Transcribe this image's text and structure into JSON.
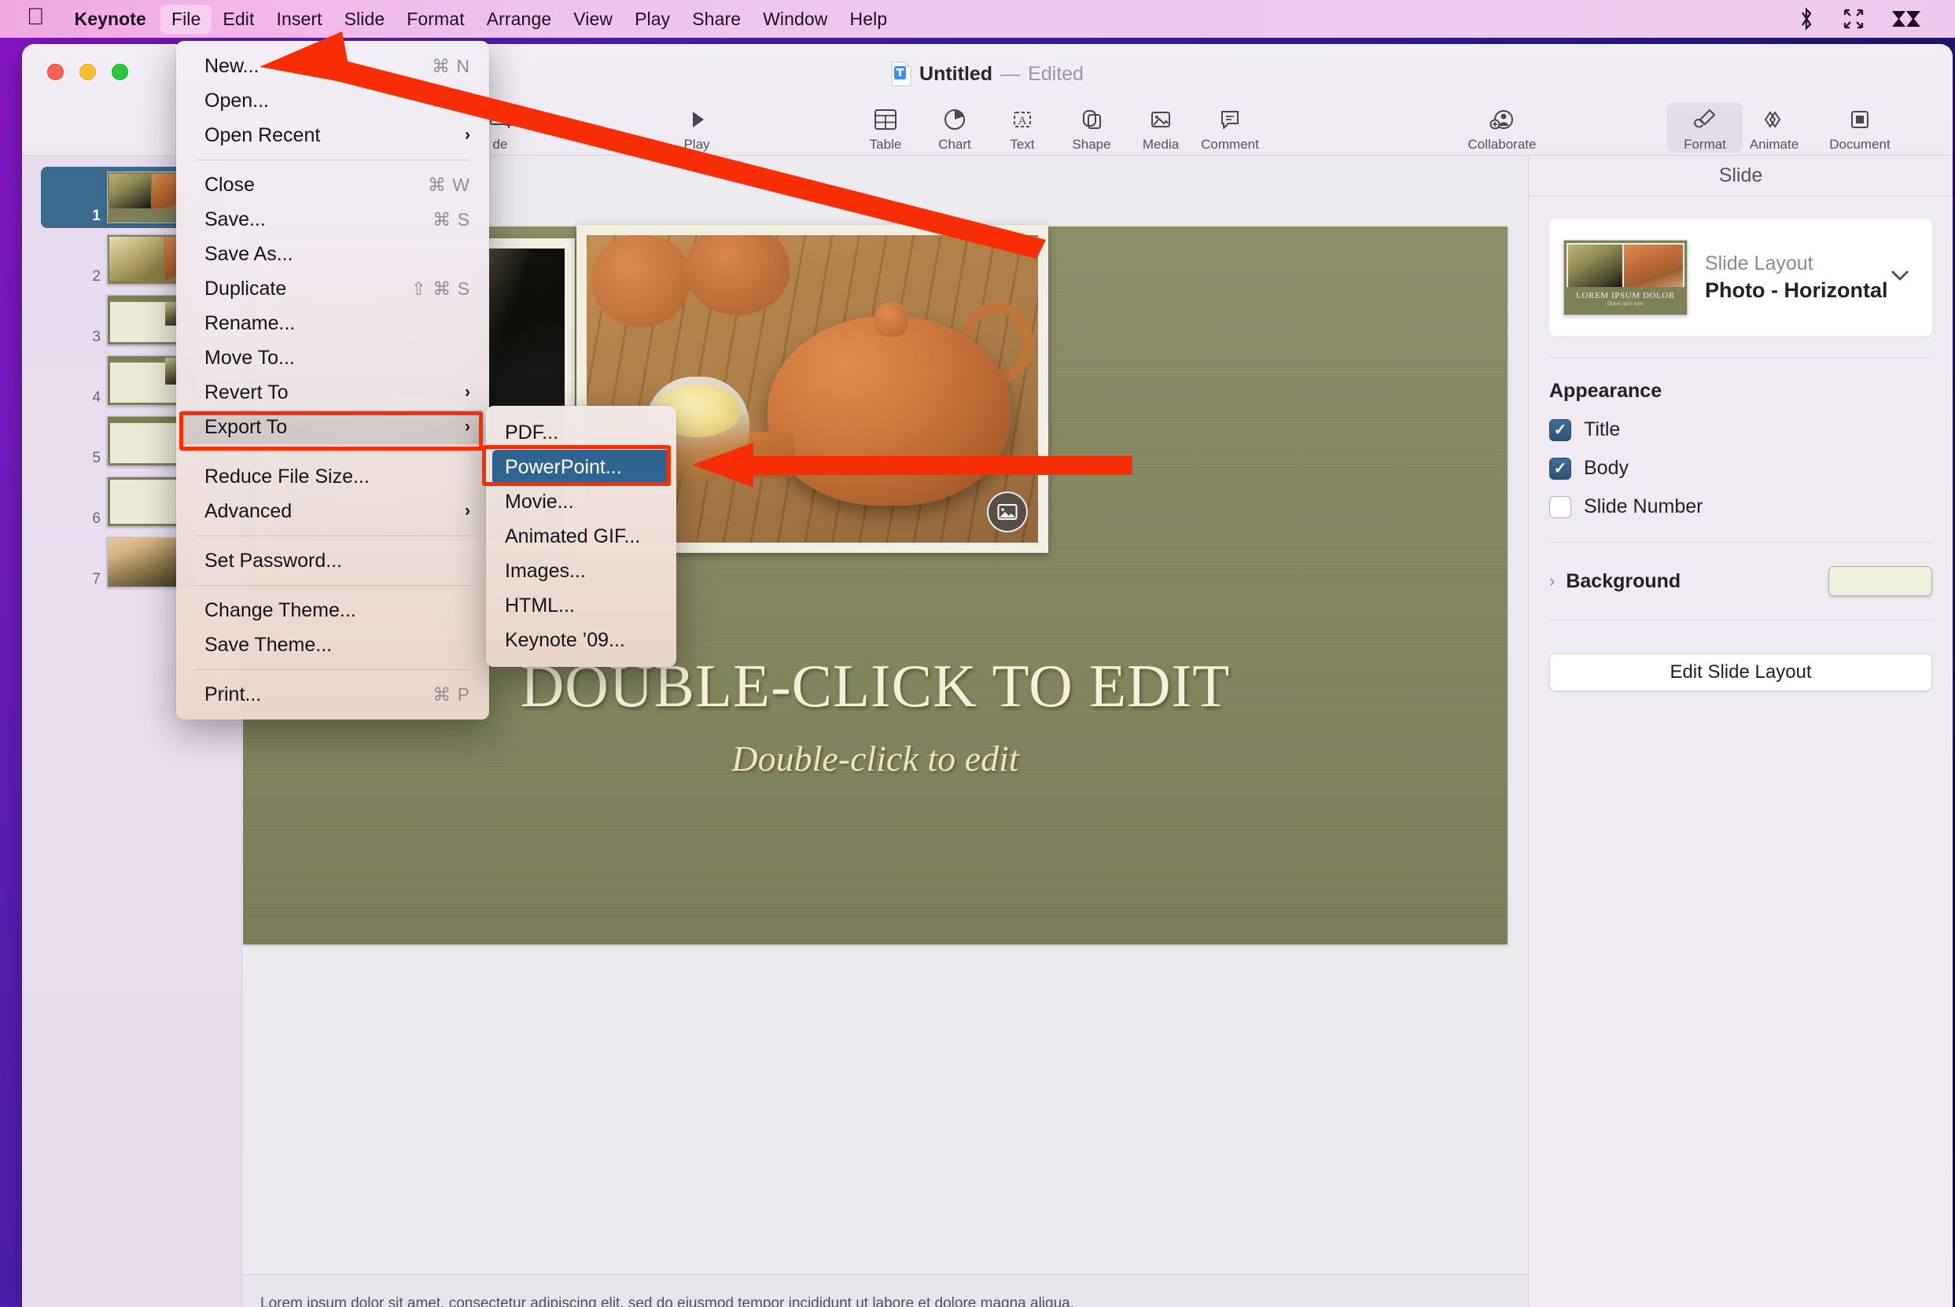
{
  "menubar": {
    "apple_icon": "apple-logo-icon",
    "items": [
      {
        "label": "Keynote",
        "bold": true,
        "active": false
      },
      {
        "label": "File",
        "bold": false,
        "active": true
      },
      {
        "label": "Edit",
        "bold": false,
        "active": false
      },
      {
        "label": "Insert",
        "bold": false,
        "active": false
      },
      {
        "label": "Slide",
        "bold": false,
        "active": false
      },
      {
        "label": "Format",
        "bold": false,
        "active": false
      },
      {
        "label": "Arrange",
        "bold": false,
        "active": false
      },
      {
        "label": "View",
        "bold": false,
        "active": false
      },
      {
        "label": "Play",
        "bold": false,
        "active": false
      },
      {
        "label": "Share",
        "bold": false,
        "active": false
      },
      {
        "label": "Window",
        "bold": false,
        "active": false
      },
      {
        "label": "Help",
        "bold": false,
        "active": false
      }
    ],
    "status_icons": [
      "bluetooth-icon",
      "fullscreen-arrows-icon",
      "leaf-logo-icon"
    ]
  },
  "window": {
    "title": "Untitled",
    "dash": "—",
    "state": "Edited",
    "doc_icon": "keynote-document-icon",
    "traffic_lights": [
      "close-button",
      "minimize-button",
      "zoom-button"
    ]
  },
  "toolbar": {
    "items": [
      {
        "label": "de",
        "icon": "add-slide-icon",
        "selected": false,
        "truncated": true
      },
      {
        "label": "Play",
        "icon": "play-triangle-icon",
        "selected": false
      },
      {
        "label": "Table",
        "icon": "table-grid-icon",
        "selected": false
      },
      {
        "label": "Chart",
        "icon": "pie-chart-icon",
        "selected": false
      },
      {
        "label": "Text",
        "icon": "text-box-icon",
        "selected": false
      },
      {
        "label": "Shape",
        "icon": "shape-icon",
        "selected": false
      },
      {
        "label": "Media",
        "icon": "media-image-icon",
        "selected": false
      },
      {
        "label": "Comment",
        "icon": "comment-bubble-icon",
        "selected": false
      },
      {
        "label": "Collaborate",
        "icon": "collaborate-person-icon",
        "selected": false
      },
      {
        "label": "Format",
        "icon": "format-brush-icon",
        "selected": true
      },
      {
        "label": "Animate",
        "icon": "animate-diamonds-icon",
        "selected": false
      },
      {
        "label": "Document",
        "icon": "document-square-icon",
        "selected": false
      }
    ]
  },
  "navigator": {
    "slides": [
      {
        "number": "1",
        "selected": true,
        "kind": "photo"
      },
      {
        "number": "2",
        "selected": false,
        "kind": "photo2"
      },
      {
        "number": "3",
        "selected": false,
        "kind": "blank-right"
      },
      {
        "number": "4",
        "selected": false,
        "kind": "blank-right"
      },
      {
        "number": "5",
        "selected": false,
        "kind": "blank"
      },
      {
        "number": "6",
        "selected": false,
        "kind": "blank"
      },
      {
        "number": "7",
        "selected": false,
        "kind": "leaf"
      }
    ]
  },
  "slide": {
    "title": "DOUBLE-CLICK TO EDIT",
    "body": "Double-click to edit",
    "media_placeholder_icon": "image-placeholder-icon",
    "notes_text": "Lorem ipsum dolor sit amet, consectetur adipiscing elit, sed do eiusmod tempor incididunt ut labore et dolore magna aliqua.",
    "background_color": "#83865d"
  },
  "inspector": {
    "header": "Slide",
    "layout": {
      "caption": "Slide Layout",
      "value": "Photo - Horizontal",
      "chevron_icon": "chevron-down-icon",
      "thumb_title": "LOREM IPSUM DOLOR",
      "thumb_sub": "Donec quis nunc"
    },
    "appearance": {
      "title": "Appearance",
      "options": [
        {
          "label": "Title",
          "checked": true
        },
        {
          "label": "Body",
          "checked": true
        },
        {
          "label": "Slide Number",
          "checked": false
        }
      ]
    },
    "background": {
      "label": "Background",
      "chevron_icon": "chevron-right-icon",
      "swatch_color": "#eef0dd"
    },
    "edit_layout_button": "Edit Slide Layout"
  },
  "file_menu": {
    "groups": [
      [
        {
          "label": "New...",
          "shortcut": "⌘ N",
          "submenu": false,
          "highlighted": false
        },
        {
          "label": "Open...",
          "shortcut": "⌘ O",
          "submenu": false,
          "highlighted": false
        },
        {
          "label": "Open Recent",
          "shortcut": "",
          "submenu": true,
          "highlighted": false
        }
      ],
      [
        {
          "label": "Close",
          "shortcut": "⌘ W",
          "submenu": false,
          "highlighted": false
        },
        {
          "label": "Save...",
          "shortcut": "⌘ S",
          "submenu": false,
          "highlighted": false
        },
        {
          "label": "Save As...",
          "shortcut": "",
          "submenu": false,
          "highlighted": false
        },
        {
          "label": "Duplicate",
          "shortcut": "⇧ ⌘ S",
          "submenu": false,
          "highlighted": false
        },
        {
          "label": "Rename...",
          "shortcut": "",
          "submenu": false,
          "highlighted": false
        },
        {
          "label": "Move To...",
          "shortcut": "",
          "submenu": false,
          "highlighted": false
        },
        {
          "label": "Revert To",
          "shortcut": "",
          "submenu": true,
          "highlighted": false
        },
        {
          "label": "Export To",
          "shortcut": "",
          "submenu": true,
          "highlighted": true
        }
      ],
      [
        {
          "label": "Reduce File Size...",
          "shortcut": "",
          "submenu": false,
          "highlighted": false
        },
        {
          "label": "Advanced",
          "shortcut": "",
          "submenu": true,
          "highlighted": false
        }
      ],
      [
        {
          "label": "Set Password...",
          "shortcut": "",
          "submenu": false,
          "highlighted": false
        }
      ],
      [
        {
          "label": "Change Theme...",
          "shortcut": "",
          "submenu": false,
          "highlighted": false
        },
        {
          "label": "Save Theme...",
          "shortcut": "",
          "submenu": false,
          "highlighted": false
        }
      ],
      [
        {
          "label": "Print...",
          "shortcut": "⌘ P",
          "submenu": false,
          "highlighted": false
        }
      ]
    ]
  },
  "export_submenu": {
    "items": [
      {
        "label": "PDF...",
        "selected": false
      },
      {
        "label": "PowerPoint...",
        "selected": true
      },
      {
        "label": "Movie...",
        "selected": false
      },
      {
        "label": "Animated GIF...",
        "selected": false
      },
      {
        "label": "Images...",
        "selected": false
      },
      {
        "label": "HTML...",
        "selected": false
      },
      {
        "label": "Keynote ’09...",
        "selected": false
      }
    ]
  },
  "annotations": {
    "accent_color": "#f72d05",
    "arrow_to_file_menu": "arrow-pointing-to-file-menu",
    "arrow_to_powerpoint": "arrow-pointing-to-powerpoint-item",
    "box_export_to": "highlight-box-export-to",
    "box_powerpoint": "highlight-box-powerpoint"
  }
}
